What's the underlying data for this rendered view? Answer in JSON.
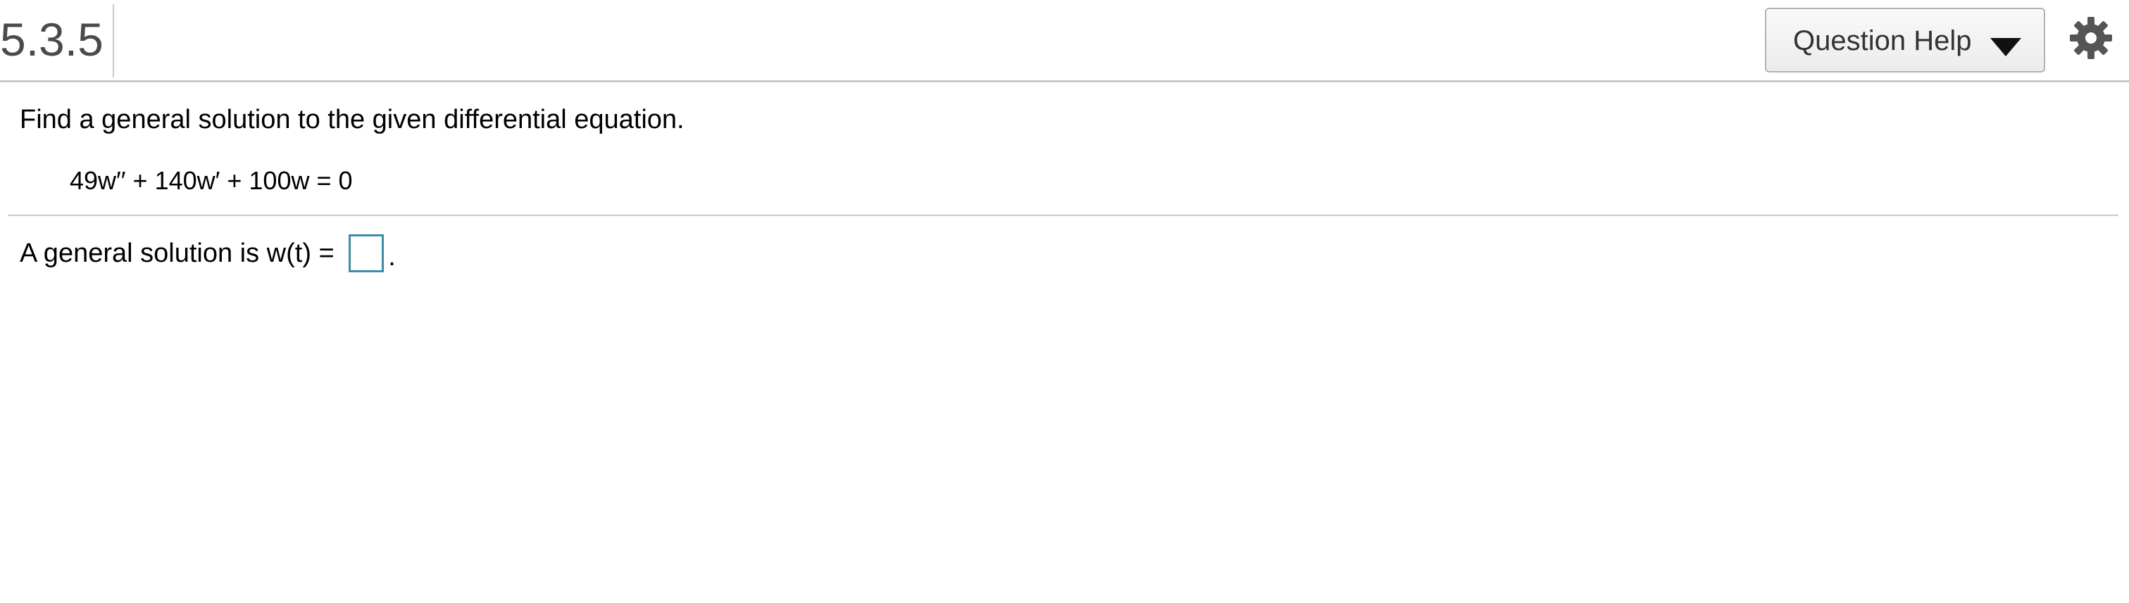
{
  "header": {
    "question_number": "5.3.5",
    "help_button_label": "Question Help",
    "help_caret_icon": "caret-down-icon",
    "settings_icon": "gear-icon"
  },
  "question": {
    "prompt": "Find a general solution to the given differential equation.",
    "equation": "49w′′ + 140w′ + 100w = 0"
  },
  "answer": {
    "label": "A general solution is w(t) = ",
    "input_value": "",
    "trailing_punctuation": "."
  },
  "colors": {
    "input_border": "#3c8da6",
    "divider": "#c8c8c8",
    "question_number_text": "#4a4a4a"
  }
}
